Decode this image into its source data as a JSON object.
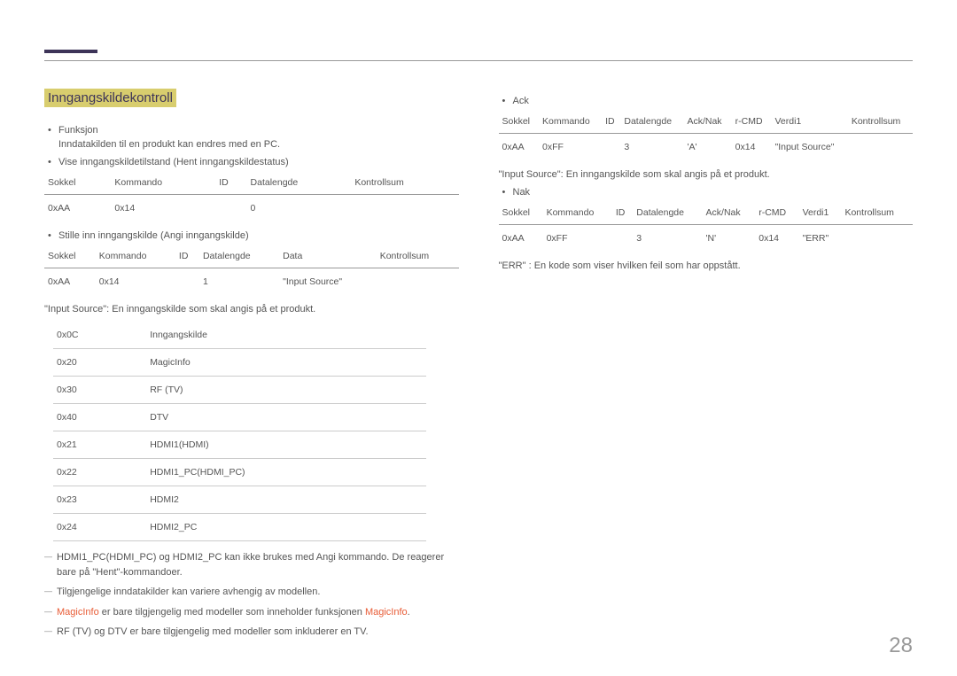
{
  "title": "Inngangskildekontroll",
  "funksjon_label": "Funksjon",
  "funksjon_desc": "Inndatakilden til en produkt kan endres med en PC.",
  "vise_label": "Vise inngangskildetilstand (Hent inngangskildestatus)",
  "headers": {
    "sokkel": "Sokkel",
    "kommando": "Kommando",
    "id": "ID",
    "datalengde": "Datalengde",
    "kontrollsum": "Kontrollsum",
    "data": "Data",
    "acknak": "Ack/Nak",
    "rcmd": "r-CMD",
    "verdi1": "Verdi1"
  },
  "t1": {
    "sokkel": "0xAA",
    "kommando": "0x14",
    "id": "",
    "datalengde": "0",
    "kontrollsum": ""
  },
  "stille_label": "Stille inn inngangskilde (Angi inngangskilde)",
  "t2": {
    "sokkel": "0xAA",
    "kommando": "0x14",
    "id": "",
    "datalengde": "1",
    "data": "\"Input Source\"",
    "kontrollsum": ""
  },
  "input_source_line": "\"Input Source\": En inngangskilde som skal angis på et produkt.",
  "sources": [
    {
      "code": "0x0C",
      "name": "Inngangskilde"
    },
    {
      "code": "0x20",
      "name": "MagicInfo"
    },
    {
      "code": "0x30",
      "name": "RF (TV)"
    },
    {
      "code": "0x40",
      "name": "DTV"
    },
    {
      "code": "0x21",
      "name": "HDMI1(HDMI)"
    },
    {
      "code": "0x22",
      "name": "HDMI1_PC(HDMI_PC)"
    },
    {
      "code": "0x23",
      "name": "HDMI2"
    },
    {
      "code": "0x24",
      "name": "HDMI2_PC"
    }
  ],
  "note1": "HDMI1_PC(HDMI_PC) og HDMI2_PC kan ikke brukes med Angi kommando. De reagerer bare på \"Hent\"-kommandoer.",
  "note2": "Tilgjengelige inndatakilder kan variere avhengig av modellen.",
  "note3_a": "MagicInfo",
  "note3_b": " er bare tilgjengelig med modeller som inneholder funksjonen ",
  "note3_c": "MagicInfo",
  "note3_d": ".",
  "note4": "RF (TV) og DTV er bare tilgjengelig med modeller som inkluderer en TV.",
  "ack_label": "Ack",
  "t3": {
    "sokkel": "0xAA",
    "kommando": "0xFF",
    "id": "",
    "datalengde": "3",
    "acknak": "'A'",
    "rcmd": "0x14",
    "verdi1": "\"Input Source\"",
    "kontrollsum": ""
  },
  "input_source_line_2": "\"Input Source\": En inngangskilde som skal angis på et produkt.",
  "nak_label": "Nak",
  "t4": {
    "sokkel": "0xAA",
    "kommando": "0xFF",
    "id": "",
    "datalengde": "3",
    "acknak": "'N'",
    "rcmd": "0x14",
    "verdi1": "\"ERR\"",
    "kontrollsum": ""
  },
  "err_line": "\"ERR\" : En kode som viser hvilken feil som har oppstått.",
  "page": "28"
}
